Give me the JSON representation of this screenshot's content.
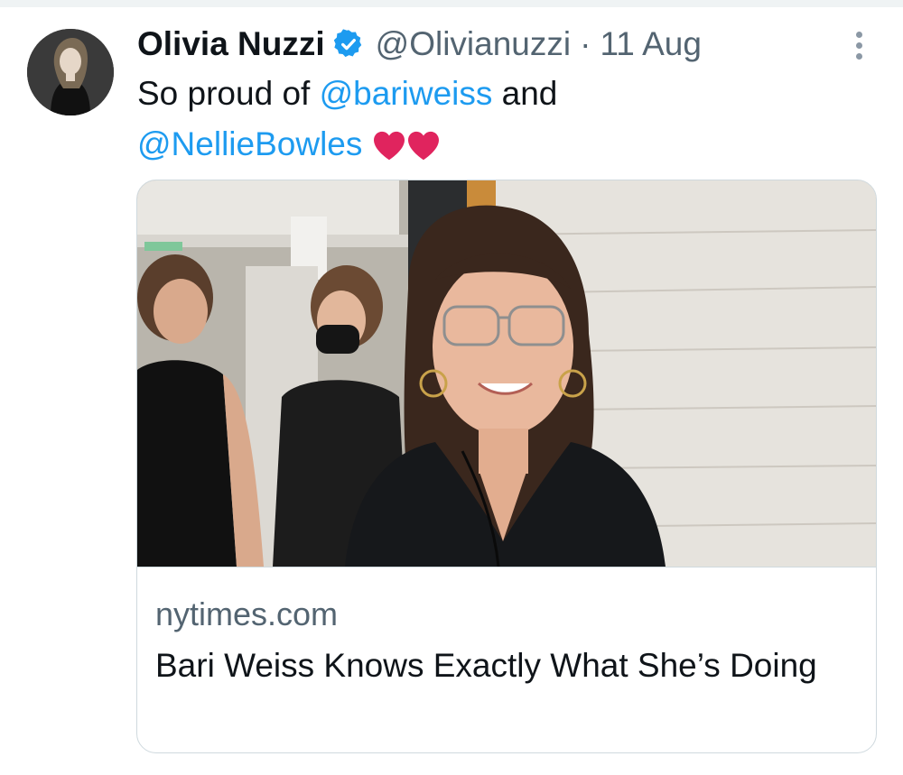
{
  "tweet": {
    "author_name": "Olivia Nuzzi",
    "author_handle": "@Olivianuzzi",
    "separator": "·",
    "timestamp": "11 Aug",
    "verified": true,
    "text_parts": [
      "So proud of ",
      "@bariweiss",
      " and ",
      "@NellieBowles"
    ],
    "emoji": [
      "heart",
      "heart"
    ]
  },
  "link_card": {
    "domain": "nytimes.com",
    "headline": "Bari Weiss Knows Exactly What She’s Doing",
    "image_icon": "article-photo"
  },
  "icons": {
    "verified": "verified-badge-icon",
    "more": "more-options-icon"
  },
  "colors": {
    "accent": "#1d9bf0",
    "text": "#0f1419",
    "secondary": "#536471",
    "border": "#cfd9de",
    "heart": "#e0245e"
  }
}
